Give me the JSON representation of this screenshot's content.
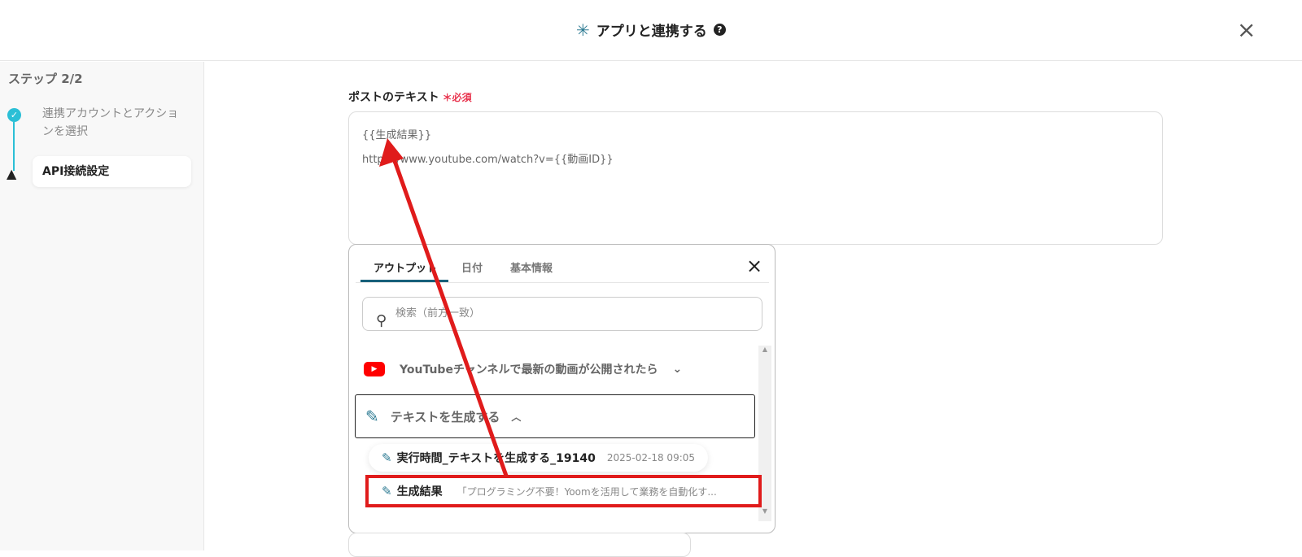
{
  "header": {
    "title": "アプリと連携する",
    "help": "?",
    "close": "×"
  },
  "sidebar": {
    "step": "ステップ 2/2",
    "items": [
      {
        "label": "連携アカウントとアクションを選択",
        "status": "done"
      },
      {
        "label": "API接続設定",
        "status": "warning"
      }
    ]
  },
  "field": {
    "label": "ポストのテキスト",
    "required": "＊必須",
    "lines": [
      "{{生成結果}}",
      "https://www.youtube.com/watch?v={{動画ID}}"
    ]
  },
  "popup": {
    "tabs": [
      "アウトプット",
      "日付",
      "基本情報"
    ],
    "close": "×",
    "search_placeholder": "検索（前方一致）",
    "groups": [
      {
        "label": "YouTubeチャンネルで最新の動画が公開されたら",
        "expanded": false
      },
      {
        "label": "テキストを生成する",
        "expanded": true
      }
    ],
    "items": [
      {
        "label": "実行時間_テキストを生成する_19140",
        "value": "2025-02-18 09:05"
      },
      {
        "label": "生成結果",
        "value": "「プログラミング不要！Yoomを活用して業務を自動化す..."
      }
    ]
  },
  "annotation": {
    "color": "#e01b1b"
  }
}
